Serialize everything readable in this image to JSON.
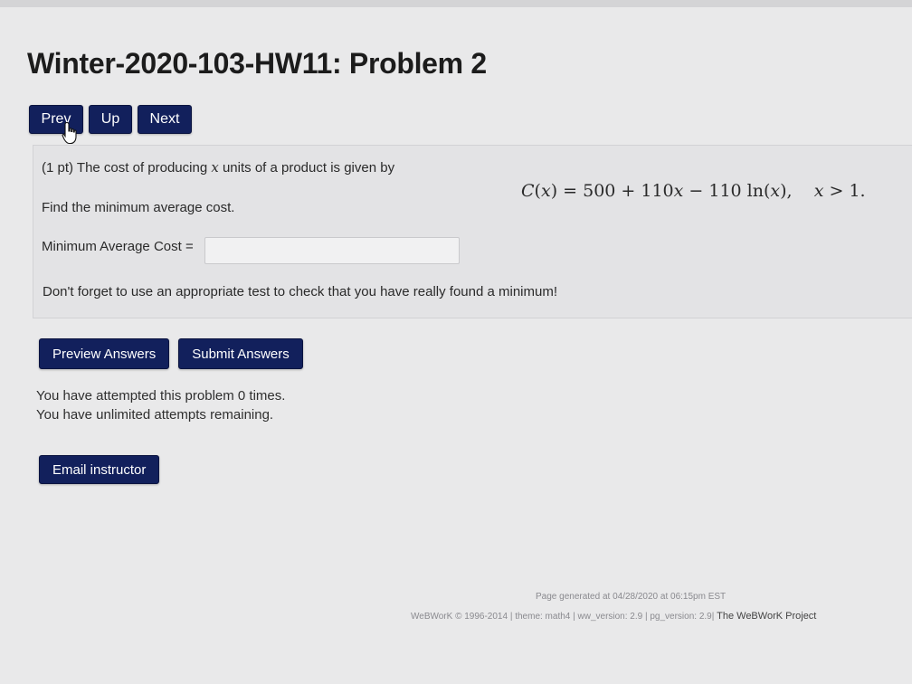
{
  "page": {
    "title": "Winter-2020-103-HW11: Problem 2"
  },
  "nav": {
    "prev_label": "Prev",
    "up_label": "Up",
    "next_label": "Next"
  },
  "problem": {
    "intro": "(1 pt) The cost of producing x units of a product is given by",
    "intro_var": "x",
    "formula": "C(x) = 500 + 110x − 110 ln(x),    x > 1.",
    "task": "Find the minimum average cost.",
    "answer_label": "Minimum Average Cost =",
    "answer_value": "",
    "reminder": "Don't forget to use an appropriate test to check that you have really found a minimum!"
  },
  "actions": {
    "preview_label": "Preview Answers",
    "submit_label": "Submit Answers"
  },
  "attempts": {
    "line1": "You have attempted this problem 0 times.",
    "line2": "You have unlimited attempts remaining."
  },
  "email": {
    "label": "Email instructor"
  },
  "footer": {
    "generated": "Page generated at 04/28/2020 at 06:15pm EST",
    "copyright": "WeBWorK © 1996-2014 | theme: math4 | ww_version: 2.9 | pg_version: 2.9|",
    "project": "The WeBWorK Project"
  },
  "colors": {
    "button": "#12205c",
    "background": "#e9e9ea"
  },
  "icons": {
    "cursor": "hand-pointer-icon"
  }
}
